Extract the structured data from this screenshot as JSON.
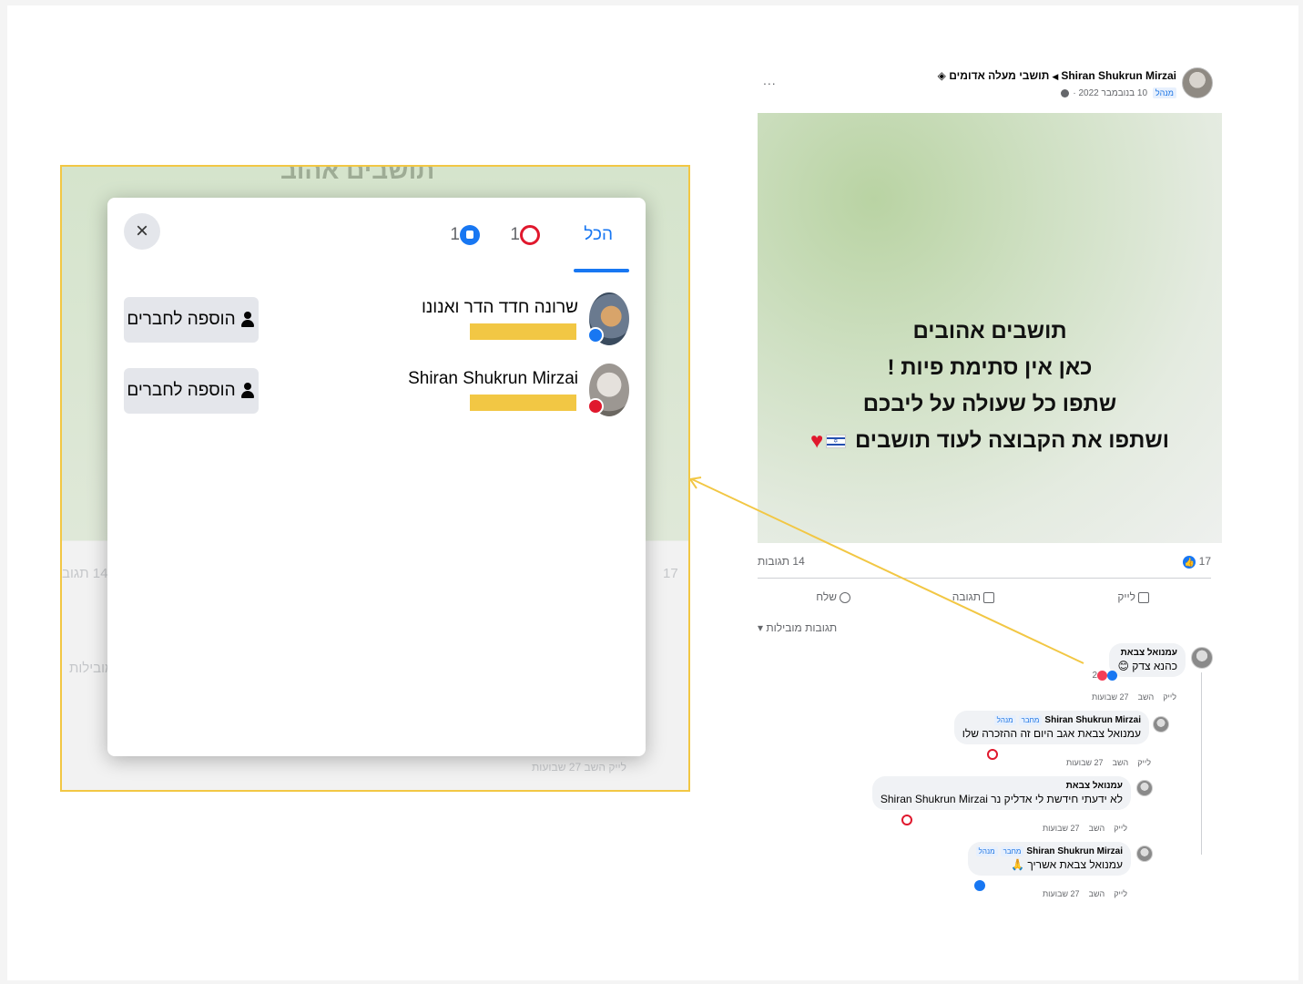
{
  "post": {
    "author": "Shiran Shukrun Mirzai",
    "group": "תושבי מעלה אדומים",
    "badge": "מנהל",
    "date": "10 בנובמבר 2022 ·",
    "more": "...",
    "text_lines": [
      "תושבים אהובים",
      "כאן אין סתימת פיות !",
      "שתפו כל שעולה על ליבכם",
      "ושתפו את הקבוצה לעוד תושבים"
    ],
    "reactions_count": "17",
    "comments_count": "14 תגובות",
    "actions": {
      "like": "לייק",
      "comment": "תגובה",
      "share": "שלח"
    },
    "relevant_filter": "תגובות מובילות"
  },
  "comments": [
    {
      "name": "עמנואל צבאת",
      "text": "כהנא צדק",
      "reaction_count": "2",
      "meta": {
        "like": "לייק",
        "reply": "השב",
        "time": "27 שבועות"
      }
    },
    {
      "name": "Shiran Shukrun Mirzai",
      "tag_author": "מחבר",
      "tag_admin": "מנהל",
      "text": "עמנואל צבאת אגב היום זה ההזכרה שלו",
      "meta": {
        "like": "לייק",
        "reply": "השב",
        "time": "27 שבועות"
      }
    },
    {
      "name": "עמנואל צבאת",
      "text": "לא ידעתי חידשת לי אדליק נר Shiran Shukrun Mirzai",
      "meta": {
        "like": "לייק",
        "reply": "השב",
        "time": "27 שבועות"
      }
    },
    {
      "name": "Shiran Shukrun Mirzai",
      "tag_author": "מחבר",
      "tag_admin": "מנהל",
      "text": "עמנואל צבאת אשריך 🙏",
      "meta": {
        "like": "לייק",
        "reply": "השב",
        "time": "27 שבועות"
      }
    }
  ],
  "modal": {
    "tabs": {
      "all": "הכל",
      "love_count": "1",
      "like_count": "1"
    },
    "close": "×",
    "people": [
      {
        "name": "שרונה חדד הדר ואנונו",
        "reaction": "like",
        "button": "הוספה לחברים"
      },
      {
        "name": "Shiran Shukrun Mirzai",
        "reaction": "love",
        "button": "הוספה לחברים"
      }
    ]
  },
  "background_ghost": {
    "title": "תושבים אהוב",
    "reactions": "17",
    "comments": "14 תגוב",
    "relevant": "מובילות",
    "meta": "לייק  השב  27 שבועות"
  },
  "colors": {
    "facebook_blue": "#1877f2",
    "highlight_yellow": "#f2c744",
    "love_red": "#e0182d"
  }
}
